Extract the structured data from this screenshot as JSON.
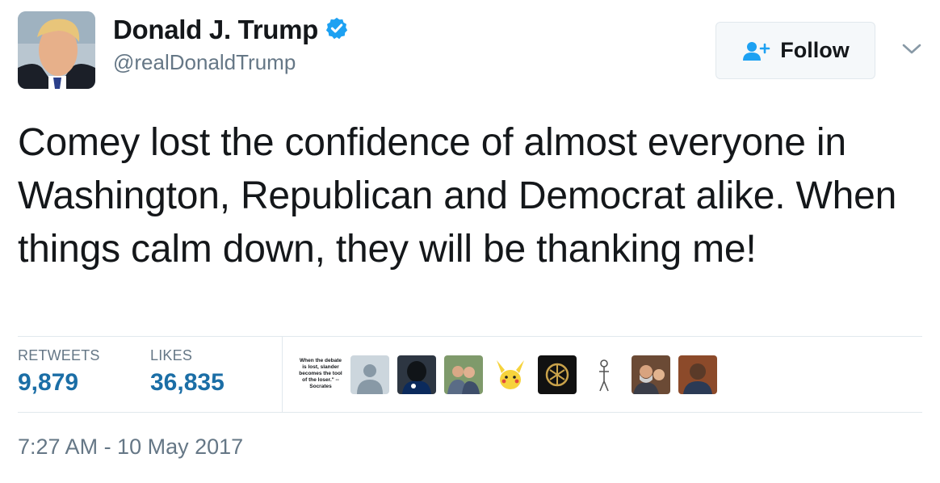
{
  "author": {
    "display_name": "Donald J. Trump",
    "handle": "@realDonaldTrump",
    "verified": true
  },
  "follow_button": {
    "label": "Follow"
  },
  "tweet": {
    "text": "Comey lost the confidence of almost everyone in Washington, Republican and Democrat alike. When things calm down, they will be thanking me!"
  },
  "stats": {
    "retweets_label": "RETWEETS",
    "retweets_count": "9,879",
    "likes_label": "LIKES",
    "likes_count": "36,835"
  },
  "likers": {
    "quote_text": "When the debate is lost, slander becomes the tool of the loser.\" -- Socrates"
  },
  "timestamp": "7:27 AM - 10 May 2017",
  "colors": {
    "verified_blue": "#1da1f2",
    "stat_value": "#1b6ea6",
    "muted": "#657786",
    "divider": "#e1e8ed"
  }
}
